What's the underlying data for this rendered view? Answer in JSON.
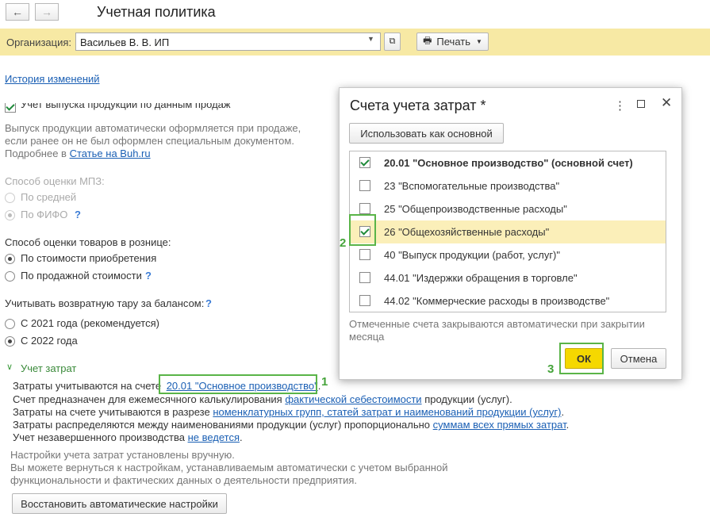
{
  "window": {
    "title": "Учетная политика"
  },
  "nav": {
    "back_glyph": "←",
    "forward_glyph": "→"
  },
  "org": {
    "label": "Организация:",
    "value": "Васильев В. В. ИП",
    "print_label": "Печать"
  },
  "history_link": "История изменений",
  "production": {
    "checkbox_label": "Учет выпуска продукции по данным продаж",
    "desc1": "Выпуск продукции автоматически оформляется при продаже,",
    "desc2": "если ранее он не был оформлен специальным документом.",
    "more_prefix": "Подробнее в",
    "more_link": "Статье на Buh.ru"
  },
  "mpz": {
    "label": "Способ оценки МПЗ:",
    "options": [
      "По средней",
      "По ФИФО"
    ],
    "help": "?"
  },
  "retail": {
    "label": "Способ оценки товаров в рознице:",
    "options": [
      "По стоимости приобретения",
      "По продажной стоимости"
    ],
    "help": "?"
  },
  "tare": {
    "label": "Учитывать возвратную тару за балансом:",
    "help": "?",
    "options": [
      "С 2021 года (рекомендуется)",
      "С 2022 года"
    ]
  },
  "costs": {
    "section_title": "Учет затрат",
    "line1_prefix": "Затраты учитываются на счете",
    "line1_link": "20.01 \"Основное производство\"",
    "line1_suffix": ".",
    "line2_prefix": "Счет предназначен для ежемесячного калькулирования",
    "line2_link": "фактической себестоимости",
    "line2_suffix": "продукции (услуг).",
    "line3_prefix": "Затраты на счете учитываются в разрезе",
    "line3_link": "номенклатурных групп, статей затрат и наименований продукции (услуг)",
    "line3_suffix": ".",
    "line4_prefix": "Затраты распределяются между наименованиями продукции (услуг) пропорционально",
    "line4_link": "суммам всех прямых затрат",
    "line4_suffix": ".",
    "line5_prefix": "Учет незавершенного производства",
    "line5_link": "не ведется",
    "line5_suffix": ".",
    "note1": "Настройки учета затрат установлены вручную.",
    "note2": "Вы можете вернуться к настройкам, устанавливаемым автоматически с учетом выбранной",
    "note3": "функциональности и фактических данных о деятельности предприятия.",
    "restore_button": "Восстановить автоматические настройки"
  },
  "dialog": {
    "title": "Счета учета затрат *",
    "use_main_button": "Использовать как основной",
    "accounts": [
      {
        "label": "20.01 \"Основное производство\" (основной счет)",
        "checked": true
      },
      {
        "label": "23 \"Вспомогательные производства\"",
        "checked": false
      },
      {
        "label": "25 \"Общепроизводственные расходы\"",
        "checked": false
      },
      {
        "label": "26 \"Общехозяйственные расходы\"",
        "checked": true
      },
      {
        "label": "40 \"Выпуск продукции (работ, услуг)\"",
        "checked": false
      },
      {
        "label": "44.01 \"Издержки обращения в торговле\"",
        "checked": false
      },
      {
        "label": "44.02 \"Коммерческие расходы в производстве\"",
        "checked": false
      }
    ],
    "note1": "Отмеченные счета закрываются автоматически при закрытии",
    "note2": "месяца",
    "ok_button": "ОК",
    "cancel_button": "Отмена"
  },
  "annotations": {
    "n1": "1",
    "n2": "2",
    "n3": "3"
  },
  "colors": {
    "accent_yellow": "#f7e9a4",
    "highlight_green": "#5ab448",
    "ok_yellow": "#f5d800"
  }
}
